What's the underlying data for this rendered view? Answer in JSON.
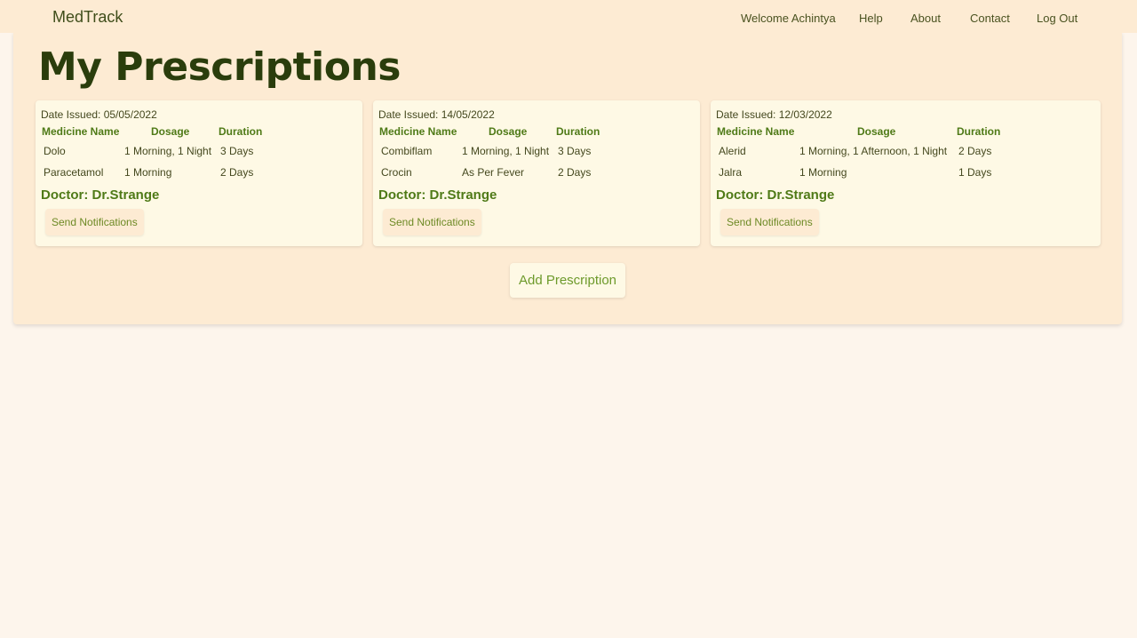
{
  "nav": {
    "brand": "MedTrack",
    "links": [
      "Welcome Achintya",
      "Help",
      "About",
      "Contact",
      "Log Out"
    ]
  },
  "page": {
    "title": "My Prescriptions"
  },
  "table_headers": {
    "medicine": "Medicine Name",
    "dosage": "Dosage",
    "duration": "Duration"
  },
  "prescriptions": [
    {
      "date": "Date Issued: 05/05/2022",
      "rows": [
        {
          "name": "Dolo",
          "dosage": "1 Morning, 1 Night",
          "duration": "3 Days"
        },
        {
          "name": "Paracetamol",
          "dosage": "1 Morning",
          "duration": "2 Days"
        }
      ],
      "doctor": "Doctor: Dr.Strange",
      "button": "Send Notifications"
    },
    {
      "date": "Date Issued: 14/05/2022",
      "rows": [
        {
          "name": "Combiflam",
          "dosage": "1 Morning, 1 Night",
          "duration": "3 Days"
        },
        {
          "name": "Crocin",
          "dosage": "As Per Fever",
          "duration": "2 Days"
        }
      ],
      "doctor": "Doctor: Dr.Strange",
      "button": "Send Notifications"
    },
    {
      "date": "Date Issued: 12/03/2022",
      "rows": [
        {
          "name": "Alerid",
          "dosage": "1 Morning, 1 Afternoon, 1 Night",
          "duration": "2 Days"
        },
        {
          "name": "Jalra",
          "dosage": "1 Morning",
          "duration": "1 Days"
        }
      ],
      "doctor": "Doctor: Dr.Strange",
      "button": "Send Notifications"
    }
  ],
  "add_button": "Add Prescription"
}
